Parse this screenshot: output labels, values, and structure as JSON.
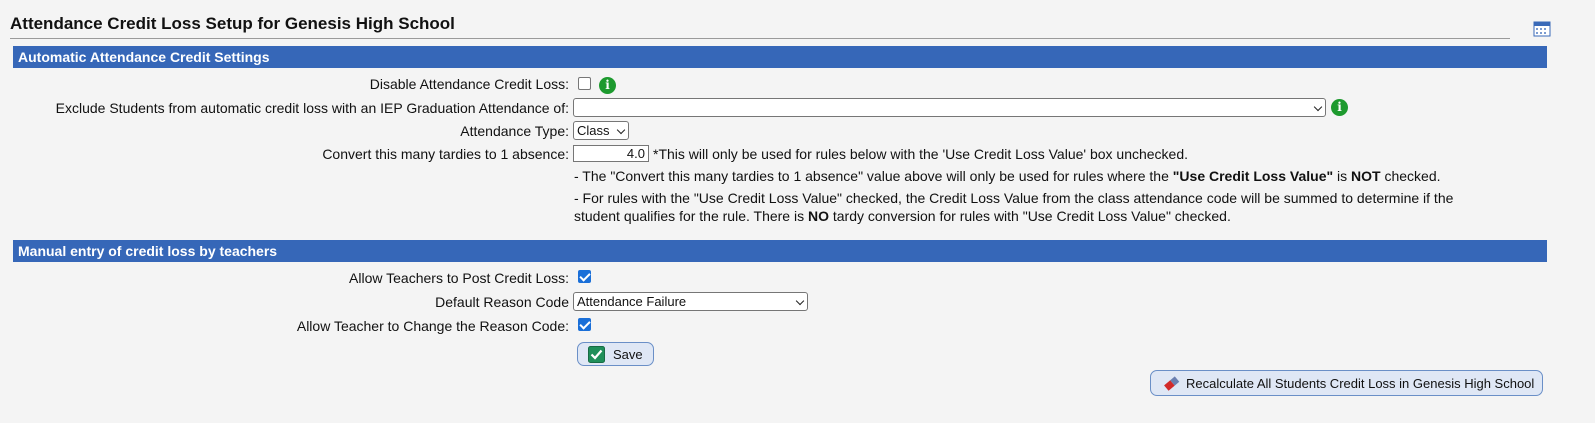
{
  "page": {
    "title": "Attendance Credit Loss Setup for Genesis High School"
  },
  "automatic_section": {
    "header": "Automatic Attendance Credit Settings",
    "disable_label": "Disable Attendance Credit Loss:",
    "disable_checked": false,
    "exclude_label": "Exclude Students from automatic credit loss with an IEP Graduation Attendance of:",
    "exclude_value": "",
    "attendance_type_label": "Attendance Type:",
    "attendance_type_value": "Class",
    "tardies_label": "Convert this many tardies to 1 absence:",
    "tardies_value": "4.0",
    "tardies_note": "*This will only be used for rules below with the 'Use Credit Loss Value' box unchecked.",
    "note1_pre": "- The \"Convert this many tardies to 1 absence\" value above will only be used for rules where the ",
    "note1_bold1": "\"Use Credit Loss Value\"",
    "note1_mid": " is ",
    "note1_bold2": "NOT",
    "note1_post": " checked.",
    "note2_line1": "- For rules with the \"Use Credit Loss Value\" checked, the Credit Loss Value from the class attendance code will be summed to determine if the",
    "note2_line2_pre": "student qualifies for the rule. There is ",
    "note2_line2_bold": "NO",
    "note2_line2_post": " tardy conversion for rules with \"Use Credit Loss Value\" checked."
  },
  "manual_section": {
    "header": "Manual entry of credit loss by teachers",
    "allow_post_label": "Allow Teachers to Post Credit Loss:",
    "allow_post_checked": true,
    "default_reason_label": "Default Reason Code",
    "default_reason_value": "Attendance Failure",
    "allow_change_label": "Allow Teacher to Change the Reason Code:",
    "allow_change_checked": true
  },
  "buttons": {
    "save_label": "Save",
    "recalc_label": "Recalculate All Students Credit Loss in Genesis High School"
  },
  "icons": {
    "info": "info-icon",
    "calendar": "calendar-icon",
    "save": "checkmark-icon",
    "recalc": "eraser-icon"
  },
  "colors": {
    "section_header_bg": "#3667b8",
    "checkbox_checked": "#1a6fd8",
    "info_green": "#1d9a2e",
    "button_bg": "#dfe7f5"
  }
}
